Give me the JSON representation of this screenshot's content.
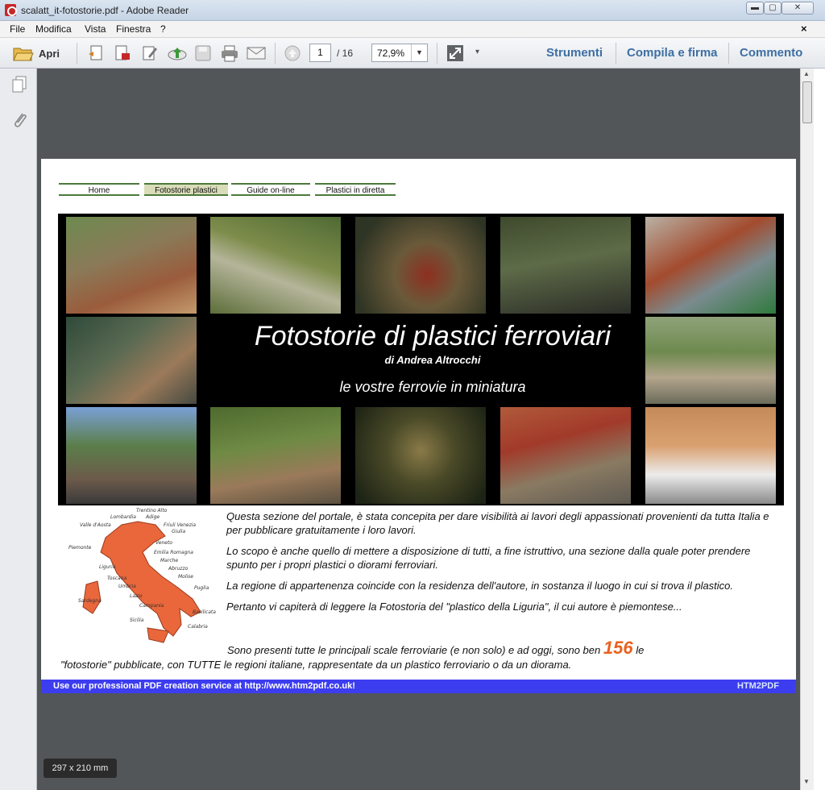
{
  "window": {
    "title": "scalatt_it-fotostorie.pdf - Adobe Reader",
    "controls": {
      "minimize": "▬",
      "maximize": "▢",
      "close": "✕"
    }
  },
  "menubar": {
    "items": [
      "File",
      "Modifica",
      "Vista",
      "Finestra",
      "?"
    ],
    "close_doc": "×"
  },
  "toolbar": {
    "open_label": "Apri",
    "page_current": "1",
    "page_total": "/ 16",
    "zoom": "72,9%",
    "tools": [
      "Strumenti",
      "Compila e firma",
      "Commento"
    ]
  },
  "page": {
    "nav": [
      "Home",
      "Fotostorie plastici",
      "Guide on-line",
      "Plastici in diretta"
    ],
    "nav_active_index": 1,
    "banner": {
      "title": "Fotostorie di plastici ferroviari",
      "author": "di Andrea Altrocchi",
      "subtitle": "le vostre ferrovie in miniatura"
    },
    "map_labels": [
      "Trentino Alto",
      "Adige",
      "Lombardia",
      "Friuli Venezia",
      "Giulia",
      "Valle d'Aosta",
      "Veneto",
      "Piemonte",
      "Emilia Romagna",
      "Marche",
      "Liguria",
      "Abruzzo",
      "Toscana",
      "Molise",
      "Umbria",
      "Puglia",
      "Lazio",
      "Sardegna",
      "Campania",
      "Basilicata",
      "Sicilia",
      "Calabria"
    ],
    "paragraphs": [
      "Questa sezione del portale, è stata concepita per dare visibilità ai lavori degli appassionati provenienti da tutta Italia e per pubblicare gratuitamente i loro lavori.",
      "Lo scopo è anche quello di mettere a disposizione di tutti, a fine istruttivo, una sezione dalla quale poter prendere spunto per i propri plastici o diorami ferroviari.",
      "La regione di appartenenza coincide con la residenza dell'autore, in sostanza il luogo in cui si trova il plastico.",
      "Pertanto vi capiterà di leggere la Fotostoria del \"plastico della Liguria\", il cui autore è piemontese..."
    ],
    "last_paragraph": {
      "before": "Sono presenti tutte le principali scale ferroviarie (e non solo) e ad oggi, sono ben",
      "count": "156",
      "after_1": "le",
      "after_2": "\"fotostorie\" pubblicate, con TUTTE le regioni italiane, rappresentate da un plastico ferroviario o da un diorama."
    },
    "promo": {
      "text": "Use our professional PDF creation service at http://www.htm2pdf.co.uk!",
      "logo": "HTM2PDF"
    }
  },
  "page_size": "297 x 210 mm",
  "colors": {
    "accent_blue": "#3d6fa3",
    "promo_bar": "#3d3df0",
    "count_orange": "#e8621f",
    "doc_background": "#525659",
    "map_orange": "#e9673b"
  }
}
